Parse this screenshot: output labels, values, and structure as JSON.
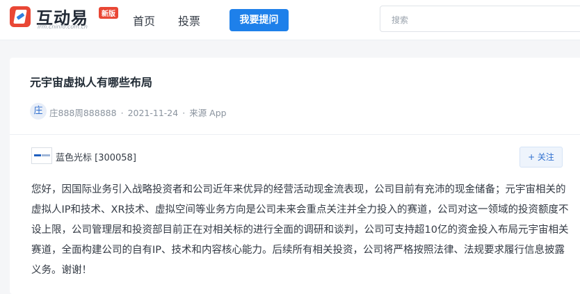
{
  "header": {
    "logo_text": "互动易",
    "logo_sub": "irm.cninfo.com.cn",
    "badge": "新版",
    "nav": [
      "首页",
      "投票"
    ],
    "ask_button": "我要提问",
    "search_placeholder": "搜索"
  },
  "question": {
    "title": "元宇宙虚拟人有哪些布局",
    "avatar_char": "庄",
    "asker": "庄888周888888",
    "date": "2021-11-24",
    "source": "来源 App",
    "separator": "·"
  },
  "answer": {
    "company": "蓝色光标 [300058]",
    "follow_label": "+ 关注",
    "text": "您好，因国际业务引入战略投资者和公司近年来优异的经营活动现金流表现，公司目前有充沛的现金储备；元宇宙相关的虚拟人IP和技术、XR技术、虚拟空间等业务方向是公司未来会重点关注并全力投入的赛道，公司对这一领域的投资额度不设上限，公司管理层和投资部目前正在对相关标的进行全面的调研和谈判，公司可支持超10亿的资金投入布局元宇宙相关赛道，全面构建公司的自有IP、技术和内容核心能力。后续所有相关投资，公司将严格按照法律、法规要求履行信息披露义务。谢谢！"
  },
  "colors": {
    "brand_red": "#e94735",
    "primary_blue": "#1e80ea"
  }
}
